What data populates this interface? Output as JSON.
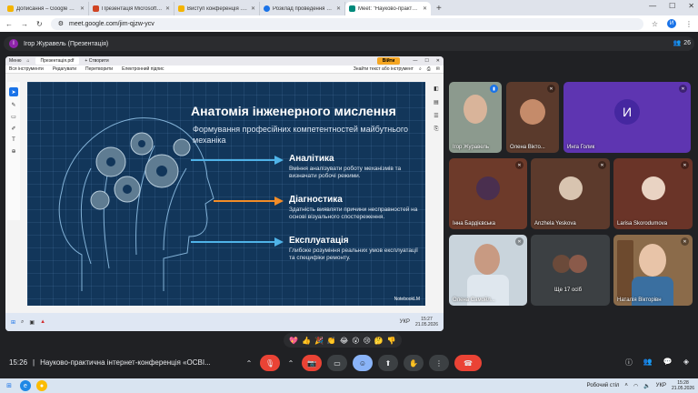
{
  "browser": {
    "tabs": [
      {
        "label": "Дописання – Google Диск",
        "color": "#f4b400"
      },
      {
        "label": "Презентація Microsoft PowerPoint",
        "color": "#d04423"
      },
      {
        "label": "Виступ конференція .pptx - Google",
        "color": "#f4b400"
      },
      {
        "label": "Розклад проведення конференц",
        "color": "#1a73e8"
      },
      {
        "label": "Meet: \"Науково-практична інт",
        "color": "#00897b"
      }
    ],
    "url": "meet.google.com/jim-qjzw-ycv",
    "profile_initial": "И"
  },
  "meet": {
    "presenter_title": "Ігор Журавель (Презентація)",
    "presenter_initial": "І",
    "participant_count": "26",
    "tiles": [
      {
        "name": "Ігор Журавель",
        "type": "video"
      },
      {
        "name": "Олена Вікто...",
        "type": "avatar"
      },
      {
        "name": "Инга Голик",
        "type": "initial",
        "initial": "И"
      },
      {
        "name": "Інна Бардієвська",
        "type": "avatar"
      },
      {
        "name": "Anzhela Yeskova",
        "type": "avatar"
      },
      {
        "name": "Larisa Skorodumova",
        "type": "avatar"
      },
      {
        "name": "Олена Самойл...",
        "type": "video"
      },
      {
        "name": "Ще 17 осіб",
        "type": "more"
      },
      {
        "name": "Наталія Вікторівн",
        "type": "video"
      }
    ],
    "reactions": [
      "💖",
      "👍",
      "🎉",
      "👏",
      "😂",
      "😮",
      "😢",
      "🤔",
      "👎"
    ],
    "time": "15:26",
    "meeting_title": "Науково-практична інтернет-конференція «ОСВІ..."
  },
  "shared_window": {
    "tab_label": "Презентація.pdf",
    "menu": "Меню",
    "new_tab": "Створити",
    "login_label": "Війти",
    "toolbar": [
      "Вся інструменти",
      "Редагувати",
      "Перетворити",
      "Електронний підпис"
    ],
    "find_label": "Знайти текст або інструмент"
  },
  "slide": {
    "title": "Анатомія інженерного мислення",
    "subtitle": "Формування професійних компетентностей майбутнього механіка",
    "items": [
      {
        "heading": "Аналітика",
        "text": "Вміння аналізувати роботу механізмів та визначати робочі режими."
      },
      {
        "heading": "Діагностика",
        "text": "Здатність виявляти причини несправностей на основі візуального спостереження."
      },
      {
        "heading": "Експлуатація",
        "text": "Глибоке розуміння реальних умов експлуатації та специфіки ремонту."
      }
    ],
    "credit": "NotebookLM"
  },
  "shared_taskbar": {
    "lang": "УКР",
    "time": "15:27",
    "date": "21.05.2026"
  },
  "taskbar": {
    "desktop": "Робочий стіл",
    "lang": "УКР",
    "time": "15:28",
    "date": "21.05.2026"
  }
}
